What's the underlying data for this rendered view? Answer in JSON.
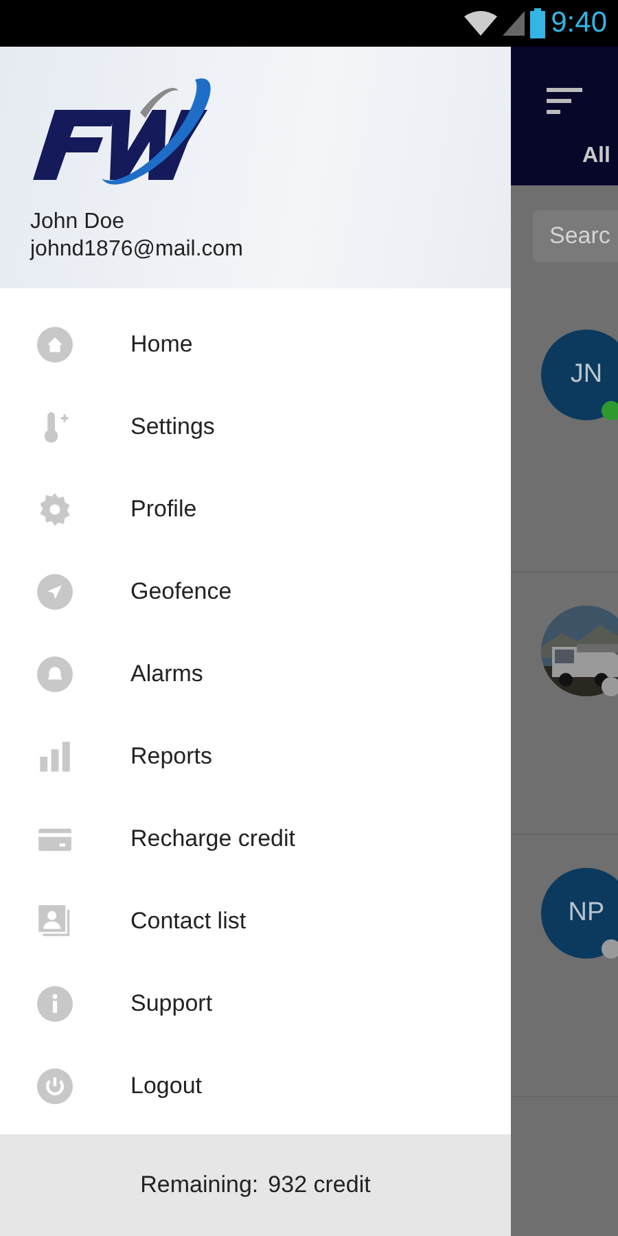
{
  "status_bar": {
    "time": "9:40"
  },
  "drawer": {
    "user": {
      "name": "John Doe",
      "email": "johnd1876@mail.com"
    },
    "items": [
      {
        "label": "Home"
      },
      {
        "label": "Settings"
      },
      {
        "label": "Profile"
      },
      {
        "label": "Geofence"
      },
      {
        "label": "Alarms"
      },
      {
        "label": "Reports"
      },
      {
        "label": "Recharge credit"
      },
      {
        "label": "Contact list"
      },
      {
        "label": "Support"
      },
      {
        "label": "Logout"
      }
    ],
    "footer": {
      "label": "Remaining:",
      "value": "932 credit"
    }
  },
  "background": {
    "tab": "All",
    "search": {
      "placeholder": "Searc"
    },
    "contacts": [
      {
        "kind": "initials",
        "initials": "JN",
        "color": "#2e9a2e"
      },
      {
        "kind": "picture",
        "color": "#9a9a9a"
      },
      {
        "kind": "initials",
        "initials": "NP",
        "color": "#9a9a9a"
      }
    ]
  }
}
